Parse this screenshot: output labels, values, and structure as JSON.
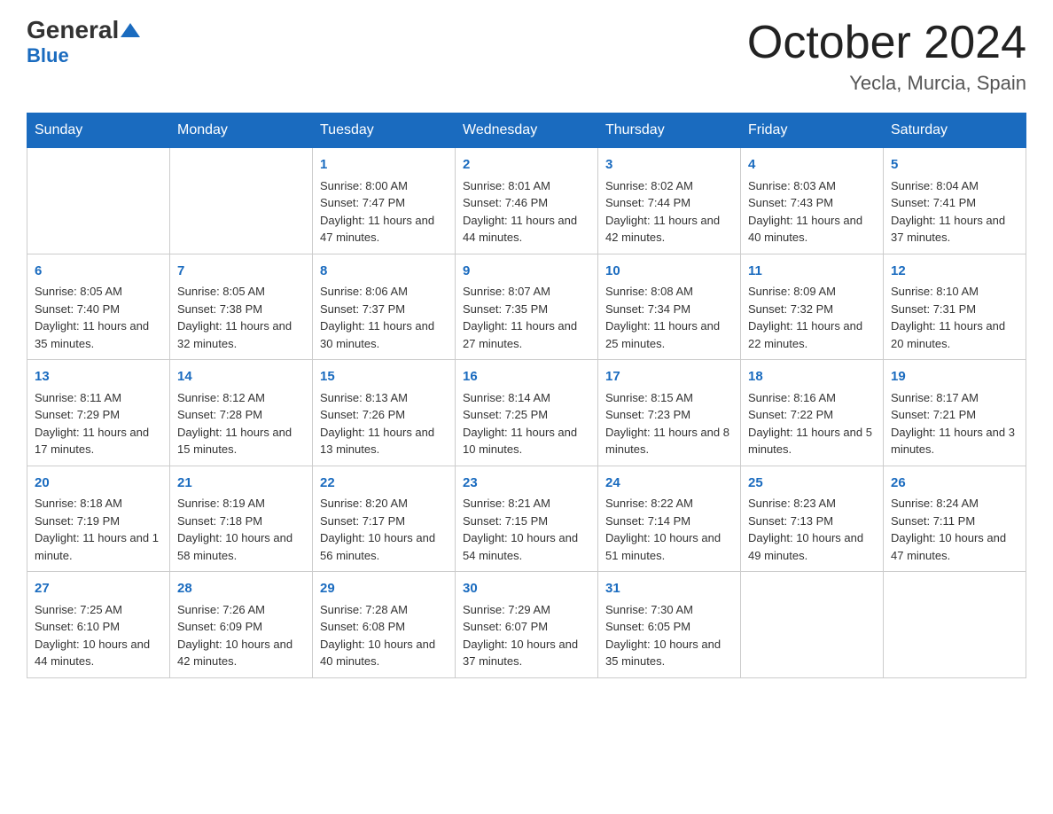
{
  "logo": {
    "text_general": "General",
    "text_blue": "Blue"
  },
  "header": {
    "month": "October 2024",
    "location": "Yecla, Murcia, Spain"
  },
  "days_of_week": [
    "Sunday",
    "Monday",
    "Tuesday",
    "Wednesday",
    "Thursday",
    "Friday",
    "Saturday"
  ],
  "weeks": [
    [
      {
        "day": "",
        "sunrise": "",
        "sunset": "",
        "daylight": ""
      },
      {
        "day": "",
        "sunrise": "",
        "sunset": "",
        "daylight": ""
      },
      {
        "day": "1",
        "sunrise": "Sunrise: 8:00 AM",
        "sunset": "Sunset: 7:47 PM",
        "daylight": "Daylight: 11 hours and 47 minutes."
      },
      {
        "day": "2",
        "sunrise": "Sunrise: 8:01 AM",
        "sunset": "Sunset: 7:46 PM",
        "daylight": "Daylight: 11 hours and 44 minutes."
      },
      {
        "day": "3",
        "sunrise": "Sunrise: 8:02 AM",
        "sunset": "Sunset: 7:44 PM",
        "daylight": "Daylight: 11 hours and 42 minutes."
      },
      {
        "day": "4",
        "sunrise": "Sunrise: 8:03 AM",
        "sunset": "Sunset: 7:43 PM",
        "daylight": "Daylight: 11 hours and 40 minutes."
      },
      {
        "day": "5",
        "sunrise": "Sunrise: 8:04 AM",
        "sunset": "Sunset: 7:41 PM",
        "daylight": "Daylight: 11 hours and 37 minutes."
      }
    ],
    [
      {
        "day": "6",
        "sunrise": "Sunrise: 8:05 AM",
        "sunset": "Sunset: 7:40 PM",
        "daylight": "Daylight: 11 hours and 35 minutes."
      },
      {
        "day": "7",
        "sunrise": "Sunrise: 8:05 AM",
        "sunset": "Sunset: 7:38 PM",
        "daylight": "Daylight: 11 hours and 32 minutes."
      },
      {
        "day": "8",
        "sunrise": "Sunrise: 8:06 AM",
        "sunset": "Sunset: 7:37 PM",
        "daylight": "Daylight: 11 hours and 30 minutes."
      },
      {
        "day": "9",
        "sunrise": "Sunrise: 8:07 AM",
        "sunset": "Sunset: 7:35 PM",
        "daylight": "Daylight: 11 hours and 27 minutes."
      },
      {
        "day": "10",
        "sunrise": "Sunrise: 8:08 AM",
        "sunset": "Sunset: 7:34 PM",
        "daylight": "Daylight: 11 hours and 25 minutes."
      },
      {
        "day": "11",
        "sunrise": "Sunrise: 8:09 AM",
        "sunset": "Sunset: 7:32 PM",
        "daylight": "Daylight: 11 hours and 22 minutes."
      },
      {
        "day": "12",
        "sunrise": "Sunrise: 8:10 AM",
        "sunset": "Sunset: 7:31 PM",
        "daylight": "Daylight: 11 hours and 20 minutes."
      }
    ],
    [
      {
        "day": "13",
        "sunrise": "Sunrise: 8:11 AM",
        "sunset": "Sunset: 7:29 PM",
        "daylight": "Daylight: 11 hours and 17 minutes."
      },
      {
        "day": "14",
        "sunrise": "Sunrise: 8:12 AM",
        "sunset": "Sunset: 7:28 PM",
        "daylight": "Daylight: 11 hours and 15 minutes."
      },
      {
        "day": "15",
        "sunrise": "Sunrise: 8:13 AM",
        "sunset": "Sunset: 7:26 PM",
        "daylight": "Daylight: 11 hours and 13 minutes."
      },
      {
        "day": "16",
        "sunrise": "Sunrise: 8:14 AM",
        "sunset": "Sunset: 7:25 PM",
        "daylight": "Daylight: 11 hours and 10 minutes."
      },
      {
        "day": "17",
        "sunrise": "Sunrise: 8:15 AM",
        "sunset": "Sunset: 7:23 PM",
        "daylight": "Daylight: 11 hours and 8 minutes."
      },
      {
        "day": "18",
        "sunrise": "Sunrise: 8:16 AM",
        "sunset": "Sunset: 7:22 PM",
        "daylight": "Daylight: 11 hours and 5 minutes."
      },
      {
        "day": "19",
        "sunrise": "Sunrise: 8:17 AM",
        "sunset": "Sunset: 7:21 PM",
        "daylight": "Daylight: 11 hours and 3 minutes."
      }
    ],
    [
      {
        "day": "20",
        "sunrise": "Sunrise: 8:18 AM",
        "sunset": "Sunset: 7:19 PM",
        "daylight": "Daylight: 11 hours and 1 minute."
      },
      {
        "day": "21",
        "sunrise": "Sunrise: 8:19 AM",
        "sunset": "Sunset: 7:18 PM",
        "daylight": "Daylight: 10 hours and 58 minutes."
      },
      {
        "day": "22",
        "sunrise": "Sunrise: 8:20 AM",
        "sunset": "Sunset: 7:17 PM",
        "daylight": "Daylight: 10 hours and 56 minutes."
      },
      {
        "day": "23",
        "sunrise": "Sunrise: 8:21 AM",
        "sunset": "Sunset: 7:15 PM",
        "daylight": "Daylight: 10 hours and 54 minutes."
      },
      {
        "day": "24",
        "sunrise": "Sunrise: 8:22 AM",
        "sunset": "Sunset: 7:14 PM",
        "daylight": "Daylight: 10 hours and 51 minutes."
      },
      {
        "day": "25",
        "sunrise": "Sunrise: 8:23 AM",
        "sunset": "Sunset: 7:13 PM",
        "daylight": "Daylight: 10 hours and 49 minutes."
      },
      {
        "day": "26",
        "sunrise": "Sunrise: 8:24 AM",
        "sunset": "Sunset: 7:11 PM",
        "daylight": "Daylight: 10 hours and 47 minutes."
      }
    ],
    [
      {
        "day": "27",
        "sunrise": "Sunrise: 7:25 AM",
        "sunset": "Sunset: 6:10 PM",
        "daylight": "Daylight: 10 hours and 44 minutes."
      },
      {
        "day": "28",
        "sunrise": "Sunrise: 7:26 AM",
        "sunset": "Sunset: 6:09 PM",
        "daylight": "Daylight: 10 hours and 42 minutes."
      },
      {
        "day": "29",
        "sunrise": "Sunrise: 7:28 AM",
        "sunset": "Sunset: 6:08 PM",
        "daylight": "Daylight: 10 hours and 40 minutes."
      },
      {
        "day": "30",
        "sunrise": "Sunrise: 7:29 AM",
        "sunset": "Sunset: 6:07 PM",
        "daylight": "Daylight: 10 hours and 37 minutes."
      },
      {
        "day": "31",
        "sunrise": "Sunrise: 7:30 AM",
        "sunset": "Sunset: 6:05 PM",
        "daylight": "Daylight: 10 hours and 35 minutes."
      },
      {
        "day": "",
        "sunrise": "",
        "sunset": "",
        "daylight": ""
      },
      {
        "day": "",
        "sunrise": "",
        "sunset": "",
        "daylight": ""
      }
    ]
  ]
}
